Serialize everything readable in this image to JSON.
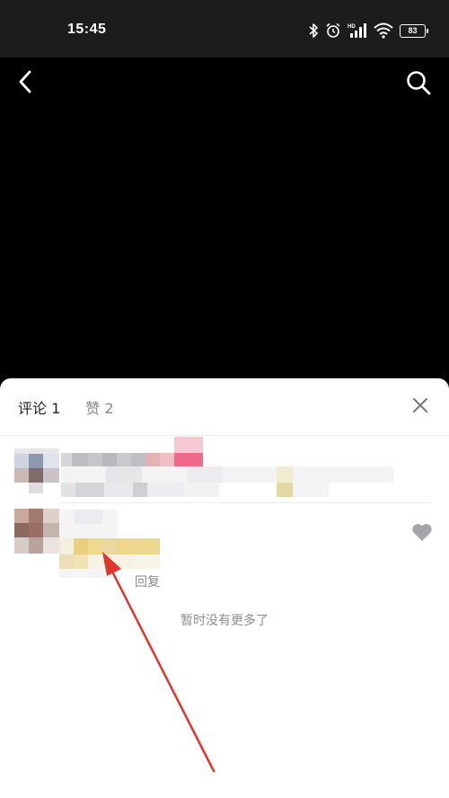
{
  "status_bar": {
    "time": "15:45",
    "battery": "83",
    "icons": [
      "bluetooth-icon",
      "alarm-icon",
      "signal-hd-icon",
      "wifi-icon",
      "battery-icon"
    ]
  },
  "nav": {
    "icons": [
      "back-arrow-icon",
      "search-icon"
    ]
  },
  "comments_panel": {
    "tabs": [
      {
        "label": "评论 1",
        "active": true
      },
      {
        "label": "赞 2",
        "active": false
      }
    ],
    "reply_label": "回复",
    "no_more_text": "暂时没有更多了",
    "close_icon": "close-icon",
    "like_icon": "heart-icon"
  },
  "colors": {
    "annotation_arrow": "#e0362c",
    "status_bar_bg": "#1c1c1c",
    "sheet_bg": "#ffffff"
  }
}
